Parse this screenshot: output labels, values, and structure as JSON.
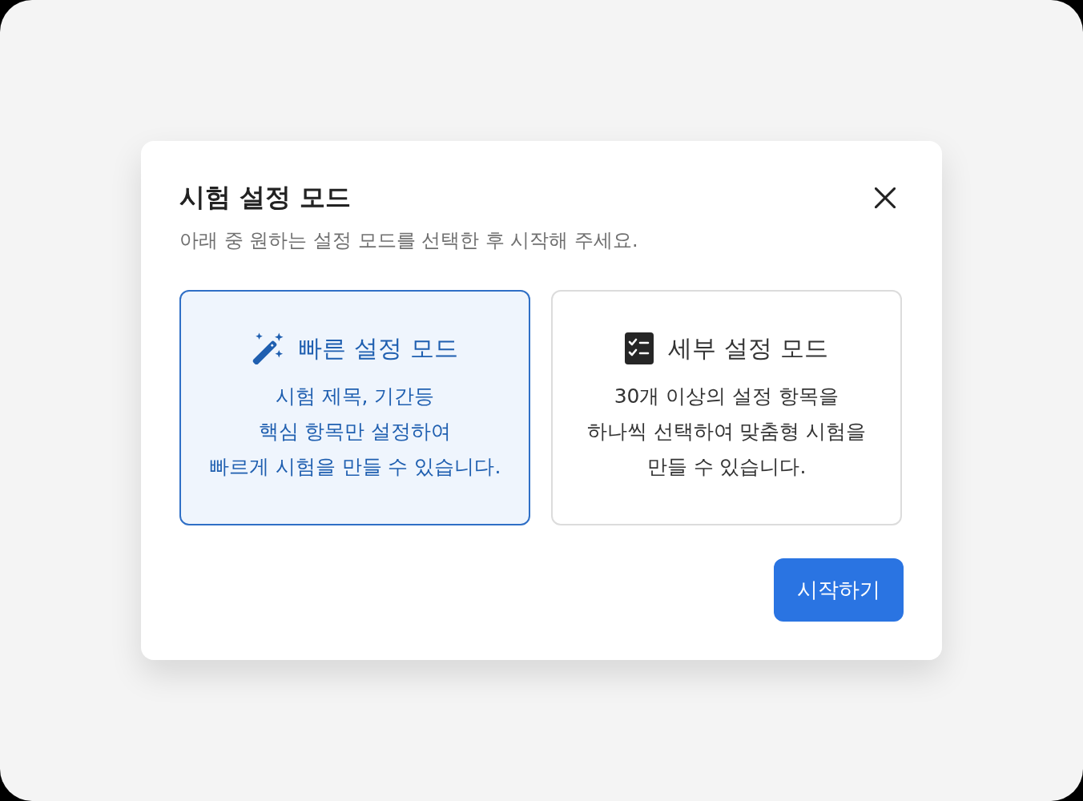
{
  "dialog": {
    "title": "시험 설정 모드",
    "subtitle": "아래 중 원하는 설정 모드를 선택한 후 시작해 주세요.",
    "options": [
      {
        "kind": "quick",
        "title": "빠른 설정 모드",
        "description": "시험 제목, 기간등\n핵심 항목만 설정하여\n빠르게 시험을 만들 수 있습니다.",
        "selected": true
      },
      {
        "kind": "detailed",
        "title": "세부 설정 모드",
        "description": "30개 이상의 설정 항목을\n하나씩 선택하여 맞춤형 시험을\n만들 수 있습니다.",
        "selected": false
      }
    ],
    "primary_button": "시작하기"
  }
}
